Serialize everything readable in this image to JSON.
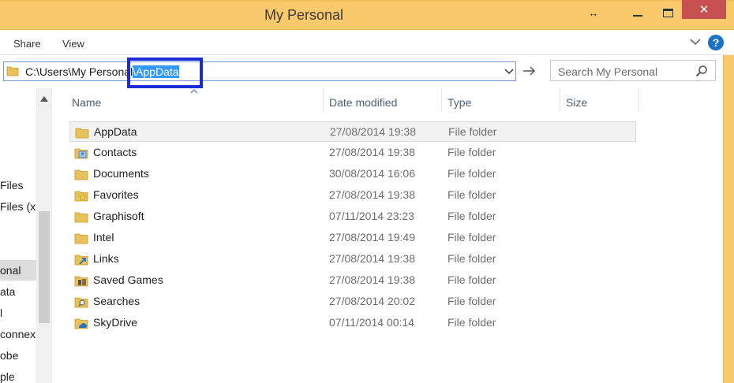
{
  "window": {
    "title": "My Personal",
    "resize_icon": "↔",
    "close_glyph": "✕"
  },
  "ribbon": {
    "tabs": [
      {
        "label": "Share"
      },
      {
        "label": "View"
      }
    ],
    "help_glyph": "?"
  },
  "address": {
    "path_prefix": "C:\\Users\\My Personal",
    "path_selected": "\\AppData",
    "search_placeholder": "Search My Personal"
  },
  "nav_pane": {
    "items": [
      {
        "label": "Files"
      },
      {
        "label": "Files (x"
      },
      {
        "label": "onal"
      },
      {
        "label": "ata"
      },
      {
        "label": "l"
      },
      {
        "label": "connex"
      },
      {
        "label": "obe"
      },
      {
        "label": "ple"
      }
    ]
  },
  "columns": {
    "name": "Name",
    "date": "Date modified",
    "type": "Type",
    "size": "Size"
  },
  "files": [
    {
      "name": "AppData",
      "date": "27/08/2014 19:38",
      "type": "File folder",
      "icon": "folder-icon"
    },
    {
      "name": "Contacts",
      "date": "27/08/2014 19:38",
      "type": "File folder",
      "icon": "contacts-folder-icon"
    },
    {
      "name": "Documents",
      "date": "30/08/2014 16:06",
      "type": "File folder",
      "icon": "folder-icon"
    },
    {
      "name": "Favorites",
      "date": "27/08/2014 19:38",
      "type": "File folder",
      "icon": "favorites-folder-icon"
    },
    {
      "name": "Graphisoft",
      "date": "07/11/2014 23:23",
      "type": "File folder",
      "icon": "folder-icon"
    },
    {
      "name": "Intel",
      "date": "27/08/2014 19:49",
      "type": "File folder",
      "icon": "folder-icon"
    },
    {
      "name": "Links",
      "date": "27/08/2014 19:38",
      "type": "File folder",
      "icon": "links-folder-icon"
    },
    {
      "name": "Saved Games",
      "date": "27/08/2014 19:38",
      "type": "File folder",
      "icon": "saved-games-folder-icon"
    },
    {
      "name": "Searches",
      "date": "27/08/2014 20:02",
      "type": "File folder",
      "icon": "searches-folder-icon"
    },
    {
      "name": "SkyDrive",
      "date": "07/11/2014 00:14",
      "type": "File folder",
      "icon": "skydrive-folder-icon"
    }
  ],
  "colors": {
    "title_bar": "#f9c96b",
    "close_button": "#c75050",
    "selection": "#3399ff",
    "highlight_frame": "#1a2bd8",
    "folder": "#e8c15a"
  }
}
